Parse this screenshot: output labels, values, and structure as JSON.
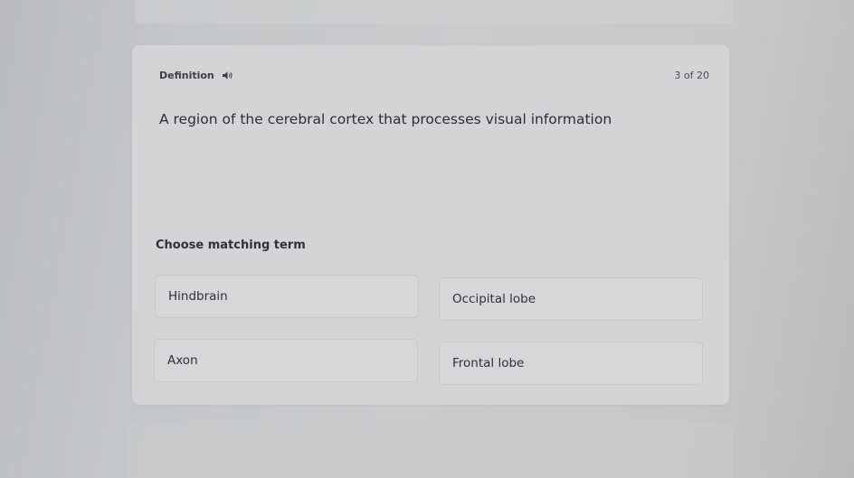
{
  "card": {
    "section_label": "Definition",
    "counter": "3 of 20",
    "definition_text": "A region of the cerebral cortex that processes visual information",
    "prompt": "Choose matching term",
    "options": [
      {
        "label": "Hindbrain"
      },
      {
        "label": "Occipital lobe"
      },
      {
        "label": "Axon"
      },
      {
        "label": "Frontal lobe"
      }
    ]
  },
  "icons": {
    "audio": "speaker-icon"
  }
}
